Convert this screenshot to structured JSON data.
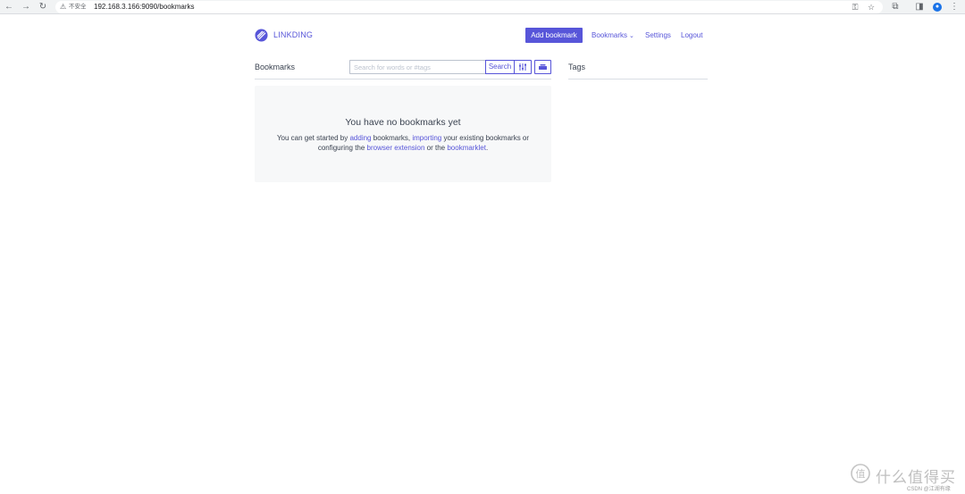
{
  "browser": {
    "back_icon": "arrow-left-icon",
    "forward_icon": "arrow-right-icon",
    "reload_icon": "reload-icon",
    "security_label": "不安全",
    "url": "192.168.3.166:9090/bookmarks"
  },
  "header": {
    "brand": "LINKDING",
    "add_bookmark": "Add bookmark",
    "nav": {
      "bookmarks": "Bookmarks",
      "settings": "Settings",
      "logout": "Logout"
    }
  },
  "bookmarks": {
    "title": "Bookmarks",
    "search_placeholder": "Search for words or #tags",
    "search_button": "Search"
  },
  "tags": {
    "title": "Tags"
  },
  "empty_state": {
    "title": "You have no bookmarks yet",
    "text_1": "You can get started by ",
    "link_adding": "adding",
    "text_2": " bookmarks, ",
    "link_importing": "importing",
    "text_3": " your existing bookmarks or configuring the ",
    "link_extension": "browser extension",
    "text_4": " or the ",
    "link_bookmarklet": "bookmarklet",
    "text_5": "."
  },
  "watermark": {
    "brand": "什么值得买",
    "sub": "CSDN @江湖有缘"
  },
  "colors": {
    "accent": "#5755d9",
    "empty_bg": "#f7f8f9",
    "text": "#3b4351"
  }
}
